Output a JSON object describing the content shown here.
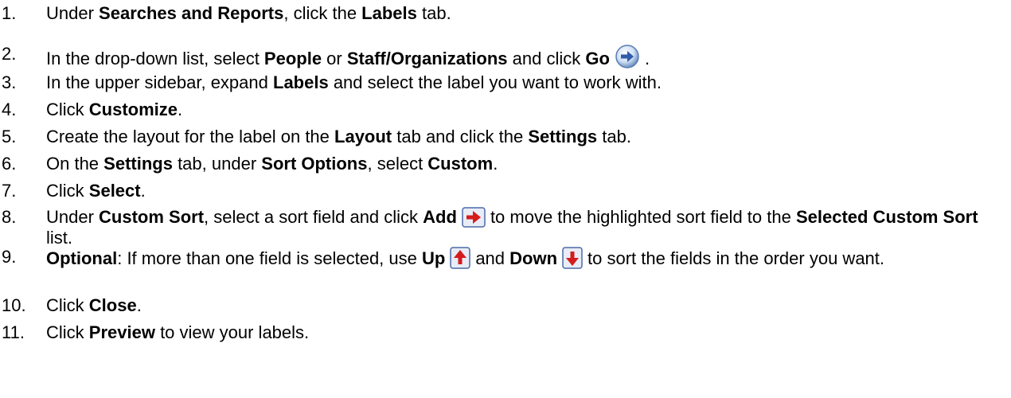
{
  "steps": [
    {
      "num": "1.",
      "parts": [
        {
          "t": "Under "
        },
        {
          "t": "Searches and Reports",
          "b": true
        },
        {
          "t": ", click the "
        },
        {
          "t": "Labels",
          "b": true
        },
        {
          "t": " tab."
        }
      ]
    },
    {
      "num": "2.",
      "parts": [
        {
          "t": "In the drop-down list, select "
        },
        {
          "t": "People",
          "b": true
        },
        {
          "t": " or "
        },
        {
          "t": "Staff/Organizations",
          "b": true
        },
        {
          "t": " and click "
        },
        {
          "t": "Go",
          "b": true
        },
        {
          "icon": "go-arrow-icon"
        },
        {
          "t": "."
        }
      ]
    },
    {
      "num": "3.",
      "parts": [
        {
          "t": "In the upper sidebar, expand "
        },
        {
          "t": "Labels",
          "b": true
        },
        {
          "t": " and select the label you want to work with."
        }
      ]
    },
    {
      "num": "4.",
      "parts": [
        {
          "t": "Click "
        },
        {
          "t": "Customize",
          "b": true
        },
        {
          "t": "."
        }
      ]
    },
    {
      "num": "5.",
      "parts": [
        {
          "t": "Create the layout for the label on the "
        },
        {
          "t": "Layout",
          "b": true
        },
        {
          "t": " tab and click the "
        },
        {
          "t": "Settings",
          "b": true
        },
        {
          "t": " tab."
        }
      ]
    },
    {
      "num": "6.",
      "parts": [
        {
          "t": "On the "
        },
        {
          "t": "Settings",
          "b": true
        },
        {
          "t": " tab, under "
        },
        {
          "t": "Sort Options",
          "b": true
        },
        {
          "t": ", select "
        },
        {
          "t": "Custom",
          "b": true
        },
        {
          "t": "."
        }
      ]
    },
    {
      "num": "7.",
      "parts": [
        {
          "t": "Click "
        },
        {
          "t": "Select",
          "b": true
        },
        {
          "t": "."
        }
      ]
    },
    {
      "num": "8.",
      "parts": [
        {
          "t": "Under "
        },
        {
          "t": "Custom Sort",
          "b": true
        },
        {
          "t": ", select a sort field and click "
        },
        {
          "t": "Add",
          "b": true
        },
        {
          "icon": "add-arrow-icon"
        },
        {
          "t": "to move the highlighted sort field to the "
        },
        {
          "t": "Selected Custom Sort",
          "b": true
        },
        {
          "t": " list."
        }
      ]
    },
    {
      "num": "9.",
      "parts": [
        {
          "t": "Optional",
          "b": true
        },
        {
          "t": ": If more than one field is selected, use "
        },
        {
          "t": "Up",
          "b": true
        },
        {
          "icon": "up-arrow-icon"
        },
        {
          "t": "and "
        },
        {
          "t": "Down",
          "b": true
        },
        {
          "icon": "down-arrow-icon"
        },
        {
          "t": "to sort the fields in the order you want."
        }
      ]
    },
    {
      "num": "10.",
      "parts": [
        {
          "t": "Click "
        },
        {
          "t": "Close",
          "b": true
        },
        {
          "t": "."
        }
      ]
    },
    {
      "num": "11.",
      "parts": [
        {
          "t": "Click "
        },
        {
          "t": "Preview",
          "b": true
        },
        {
          "t": " to view your labels."
        }
      ]
    }
  ]
}
